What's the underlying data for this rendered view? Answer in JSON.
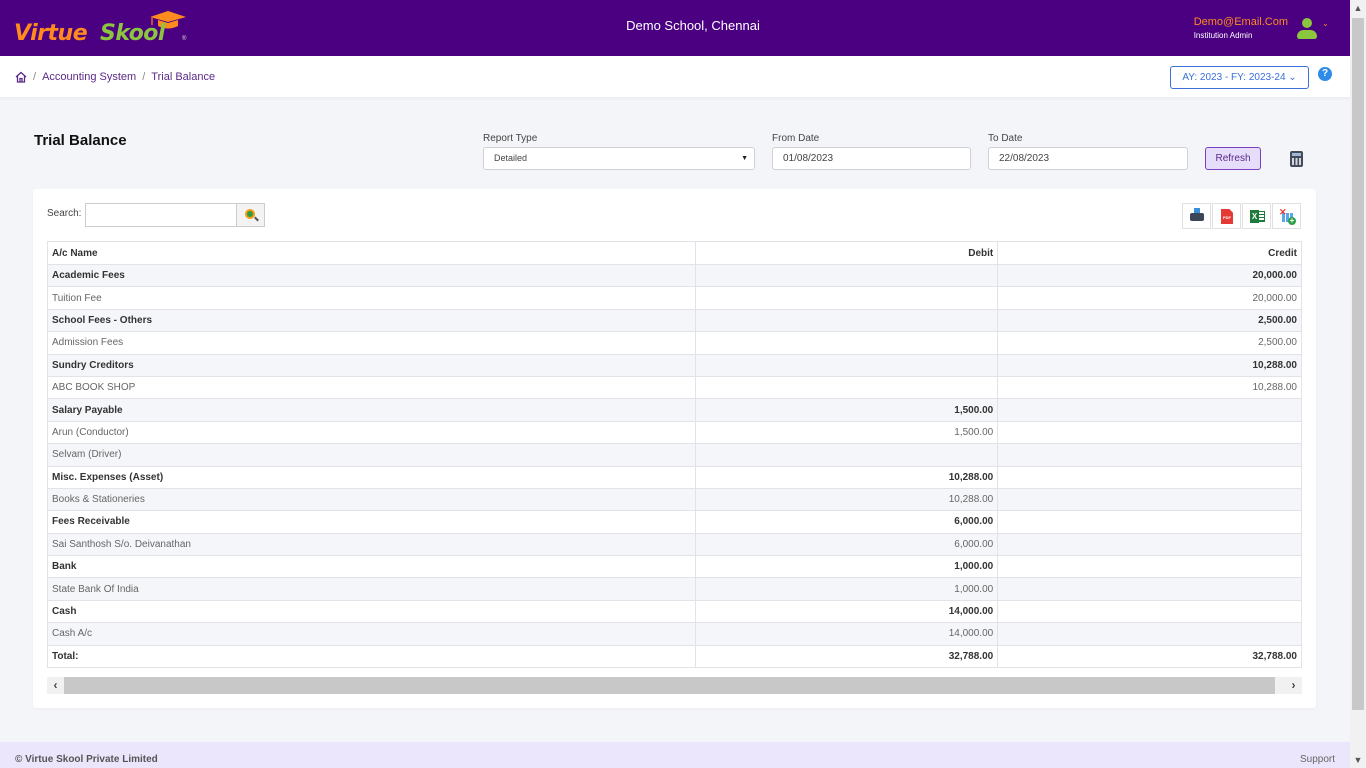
{
  "header": {
    "brand_part1": "Virtue",
    "brand_part2": "Skool",
    "brand_reg": "®",
    "school_name": "Demo School, Chennai",
    "user_email": "Demo@Email.Com",
    "user_role": "Institution Admin",
    "user_caret": "⌄"
  },
  "breadcrumb": {
    "items": [
      "Accounting System",
      "Trial Balance"
    ],
    "separator": "/"
  },
  "academic_year": {
    "selected": "AY: 2023 - FY: 2023-24 ⌄"
  },
  "help": {
    "label": "?"
  },
  "page": {
    "title": "Trial Balance"
  },
  "filters": {
    "report_type_label": "Report Type",
    "report_type_value": "Detailed",
    "from_date_label": "From Date",
    "from_date_value": "01/08/2023",
    "to_date_label": "To Date",
    "to_date_value": "22/08/2023",
    "refresh_label": "Refresh"
  },
  "search": {
    "label": "Search:",
    "value": ""
  },
  "exports": {
    "pdf_text": "PDF",
    "excel_text": "X"
  },
  "table": {
    "columns": [
      "A/c Name",
      "Debit",
      "Credit"
    ],
    "rows": [
      {
        "type": "group",
        "name": "Academic Fees",
        "debit": "",
        "credit": "20,000.00"
      },
      {
        "type": "item",
        "name": "Tuition Fee",
        "debit": "",
        "credit": "20,000.00"
      },
      {
        "type": "group",
        "name": "School Fees - Others",
        "debit": "",
        "credit": "2,500.00"
      },
      {
        "type": "item",
        "name": "Admission Fees",
        "debit": "",
        "credit": "2,500.00"
      },
      {
        "type": "group",
        "name": "Sundry Creditors",
        "debit": "",
        "credit": "10,288.00"
      },
      {
        "type": "item",
        "name": "ABC BOOK SHOP",
        "debit": "",
        "credit": "10,288.00"
      },
      {
        "type": "group",
        "name": "Salary Payable",
        "debit": "1,500.00",
        "credit": ""
      },
      {
        "type": "item",
        "name": "Arun (Conductor)",
        "debit": "1,500.00",
        "credit": ""
      },
      {
        "type": "item",
        "name": "Selvam (Driver)",
        "debit": "",
        "credit": ""
      },
      {
        "type": "group",
        "name": "Misc. Expenses (Asset)",
        "debit": "10,288.00",
        "credit": ""
      },
      {
        "type": "item",
        "name": "Books & Stationeries",
        "debit": "10,288.00",
        "credit": ""
      },
      {
        "type": "group",
        "name": "Fees Receivable",
        "debit": "6,000.00",
        "credit": ""
      },
      {
        "type": "item",
        "name": "Sai Santhosh S/o. Deivanathan",
        "debit": "6,000.00",
        "credit": ""
      },
      {
        "type": "group",
        "name": "Bank",
        "debit": "1,000.00",
        "credit": ""
      },
      {
        "type": "item",
        "name": "State Bank Of India",
        "debit": "1,000.00",
        "credit": ""
      },
      {
        "type": "group",
        "name": "Cash",
        "debit": "14,000.00",
        "credit": ""
      },
      {
        "type": "item",
        "name": "Cash A/c",
        "debit": "14,000.00",
        "credit": ""
      }
    ],
    "total": {
      "name": "Total:",
      "debit": "32,788.00",
      "credit": "32,788.00"
    }
  },
  "footer": {
    "copyright": "© Virtue Skool Private Limited",
    "support": "Support"
  },
  "colors": {
    "header_bg": "#4b0082",
    "brand_orange": "#ff8a1e",
    "brand_green": "#8cc63f",
    "link_purple": "#5b2a86",
    "accent_blue": "#3a6fd6",
    "footer_bg": "#ebe6fb"
  }
}
